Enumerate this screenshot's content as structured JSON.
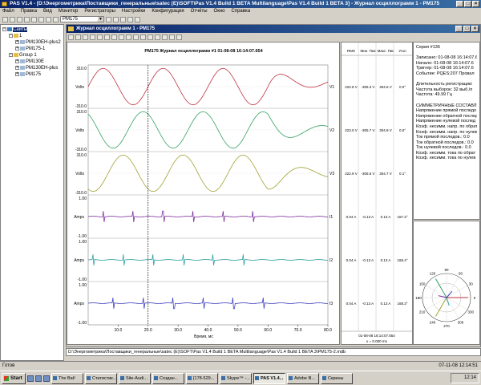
{
  "window": {
    "title": "PAS V1.4 - [D:\\Энергометрика\\Поставщики_генеральные\\satec (E)\\SOFT\\Pas V1.4 Build 1 BETA Multilanguage\\Pas V1.4 Build 1 BETA 3] - Журнал осциллограмм 1 - PM175"
  },
  "menu": [
    "Файл",
    "Правка",
    "Вид",
    "Монитор",
    "Регистраторы",
    "Настройки",
    "Конфигурация",
    "Отчёты",
    "Окно",
    "Справка"
  ],
  "toolbar": {
    "device": "PM175"
  },
  "tree": {
    "root": "Сайты",
    "items": [
      {
        "label": "1",
        "level": 1,
        "type": "folder"
      },
      {
        "label": "PM130EH-plus2",
        "level": 2,
        "type": "device"
      },
      {
        "label": "PM175-1",
        "level": 2,
        "type": "device"
      },
      {
        "label": "Group 1",
        "level": 1,
        "type": "folder"
      },
      {
        "label": "PM130E",
        "level": 2,
        "type": "device"
      },
      {
        "label": "PM130EH-plus",
        "level": 2,
        "type": "device"
      },
      {
        "label": "PM175",
        "level": 2,
        "type": "device"
      }
    ]
  },
  "child": {
    "title": "Журнал осциллограмм 1 - PM175",
    "plot_title": "PM175  Журнал осциллограмм #1   01-08-08   16:14:07.654",
    "x_axis_label": "Время, мс"
  },
  "chart_data": {
    "type": "line",
    "xlim": [
      0,
      80
    ],
    "x_ticks": [
      "10.0",
      "20.0",
      "30.0",
      "40.0",
      "50.0",
      "60.0",
      "70.0",
      "80.0"
    ],
    "cursor_x": 20,
    "panels": [
      {
        "name": "V1",
        "ylabel": "Volts",
        "ytop": "310.0",
        "ybot": "-310.0",
        "color": "#c03040",
        "phase": 0
      },
      {
        "name": "V2",
        "ylabel": "Volts",
        "ytop": "310.0",
        "ybot": "-310.0",
        "color": "#30a060",
        "phase": 120
      },
      {
        "name": "V3",
        "ylabel": "Volts",
        "ytop": "310.0",
        "ybot": "-310.0",
        "color": "#a0a030",
        "phase": 240
      },
      {
        "name": "I1",
        "ylabel": "Amps",
        "ytop": "1.00",
        "ybot": "-1.00",
        "color": "#8030a0"
      },
      {
        "name": "I2",
        "ylabel": "Amps",
        "ytop": "1.00",
        "ybot": "-1.00",
        "color": "#30a0a0"
      },
      {
        "name": "I3",
        "ylabel": "Amps",
        "ytop": "1.00",
        "ybot": "-1.00",
        "color": "#4040c0"
      }
    ]
  },
  "table": {
    "headers": [
      "RMS",
      "Мин. Пик",
      "Макс. Пик",
      "Угол"
    ],
    "rows": [
      [
        "222.8 V",
        "-305.3 V",
        "304.6 V",
        "0.0°"
      ],
      [
        "223.0 V",
        "-305.7 V",
        "304.9 V",
        "0.0°"
      ],
      [
        "222.9 V",
        "-305.6 V",
        "304.7 V",
        "0.1°"
      ],
      [
        "0.04 A",
        "-0.13 A",
        "0.13 A",
        "167.3°"
      ],
      [
        "0.04 A",
        "-0.13 A",
        "0.13 A",
        "168.4°"
      ],
      [
        "0.04 A",
        "-0.13 A",
        "0.13 A",
        "168.3°"
      ]
    ],
    "footer_time": "01-08-08 16:14:07.654",
    "footer_x": "x = 0.000 ms"
  },
  "info": {
    "lines": [
      "Серия #136",
      "",
      "Записано: 01-08-08 16:14:07.6",
      "Начало:   01-08-08 16:14:07.6",
      "Триггер:  01-08-08 16:14:07.6",
      "Событие: PQES:207 Провал",
      "",
      "Длительность регистрации:",
      "Частота выборок: 32 выб./п",
      "Частота: 49.99 Гц",
      "",
      "СИММЕТРИЧНЫЕ СОСТАВЛЯ",
      "Напряжение прямой последо",
      "Напряжение обратной послед",
      "Напряжение нулевой послед",
      "Коэф. несимм. напр. по обрат",
      "Коэф. несимм. напр. по нулев",
      "Ток прямой последов.: 0.0",
      "Ток обратной последов.: 0.0",
      "Ток нулевой последов.: 0.0",
      "Коэф. несимм. тока по обрат",
      "Коэф. несимм. тока по нулев"
    ]
  },
  "phasor": {
    "angles": [
      "90",
      "60",
      "30",
      "0",
      "330",
      "300",
      "270",
      "240",
      "210",
      "180",
      "150",
      "120"
    ]
  },
  "status_path": "D:\\Энергометрика\\Поставщики_генеральные\\satec (E)\\SOFT\\Pas V1.4 Build 1 BETA Multilanguage\\Pas V1.4 Build 1 BETA 3\\PM175-2.mdb",
  "status": {
    "ready": "Готов",
    "datetime": "07-11-08 12:14:51"
  },
  "taskbar": {
    "start": "Start",
    "tasks": [
      "The Bat!",
      "Статистик...",
      "Site-Audi...",
      "Создан...",
      "[178-529...",
      "Skype™ -...",
      "PAS V1.4...",
      "Adobe Ill...",
      "Скрины"
    ],
    "clock": "12:14"
  }
}
